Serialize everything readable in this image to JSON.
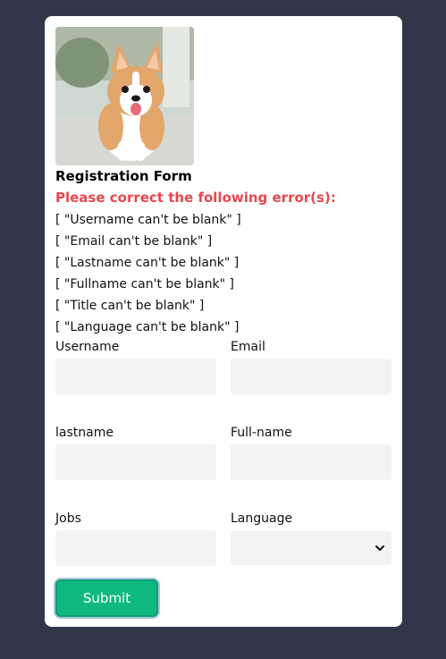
{
  "form": {
    "title": "Registration Form",
    "error_heading": "Please correct the following error(s):",
    "errors": [
      "[ \"Username can't be blank\" ]",
      "[ \"Email can't be blank\" ]",
      "[ \"Lastname can't be blank\" ]",
      "[ \"Fullname can't be blank\" ]",
      "[ \"Title can't be blank\" ]",
      "[ \"Language can't be blank\" ]"
    ],
    "fields": {
      "username": {
        "label": "Username",
        "value": ""
      },
      "email": {
        "label": "Email",
        "value": ""
      },
      "lastname": {
        "label": "lastname",
        "value": ""
      },
      "fullname": {
        "label": "Full-name",
        "value": ""
      },
      "jobs": {
        "label": "Jobs",
        "value": ""
      },
      "language": {
        "label": "Language",
        "selected": ""
      }
    },
    "submit_label": "Submit"
  },
  "image": {
    "subject": "corgi-puppy-photo"
  },
  "colors": {
    "page_background": "#32364a",
    "card_background": "#ffffff",
    "error_text": "#e5484d",
    "input_background": "#f2f3f5",
    "submit_background": "#10b981"
  }
}
